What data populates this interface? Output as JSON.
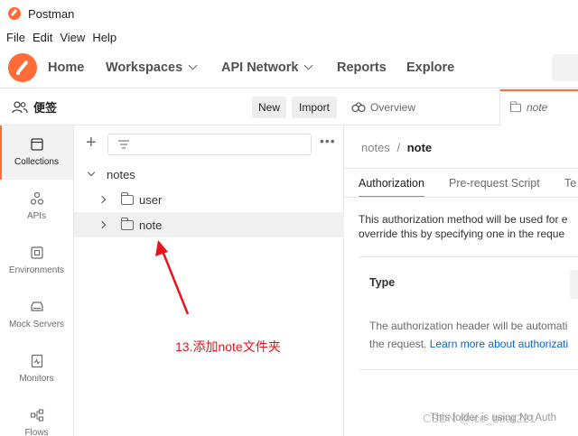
{
  "app": {
    "title": "Postman"
  },
  "menu": [
    "File",
    "Edit",
    "View",
    "Help"
  ],
  "nav": {
    "home": "Home",
    "workspaces": "Workspaces",
    "api_network": "API Network",
    "reports": "Reports",
    "explore": "Explore"
  },
  "workspace": {
    "name": "便签",
    "new_label": "New",
    "import_label": "Import"
  },
  "rail": [
    {
      "label": "Collections",
      "icon": "collections-icon"
    },
    {
      "label": "APIs",
      "icon": "apis-icon"
    },
    {
      "label": "Environments",
      "icon": "environments-icon"
    },
    {
      "label": "Mock Servers",
      "icon": "mock-servers-icon"
    },
    {
      "label": "Monitors",
      "icon": "monitors-icon"
    },
    {
      "label": "Flows",
      "icon": "flows-icon"
    }
  ],
  "tree": {
    "collection": "notes",
    "folders": [
      "user",
      "note"
    ]
  },
  "annotation": "13.添加note文件夹",
  "tabs": {
    "overview": "Overview",
    "active": "note"
  },
  "breadcrumb": {
    "parent": "notes",
    "sep": "/",
    "current": "note"
  },
  "subtabs": [
    "Authorization",
    "Pre-request Script",
    "Te"
  ],
  "auth": {
    "desc_line1": "This authorization method will be used for e",
    "desc_line2": "override this by specifying one in the reque",
    "type_label": "Type",
    "help_line1": "The authorization header will be automati",
    "help_prefix": "the request.",
    "help_link": "Learn more about authorizati",
    "footer": "This folder is using No Auth"
  },
  "watermark": "CSDN @ice_bear221"
}
